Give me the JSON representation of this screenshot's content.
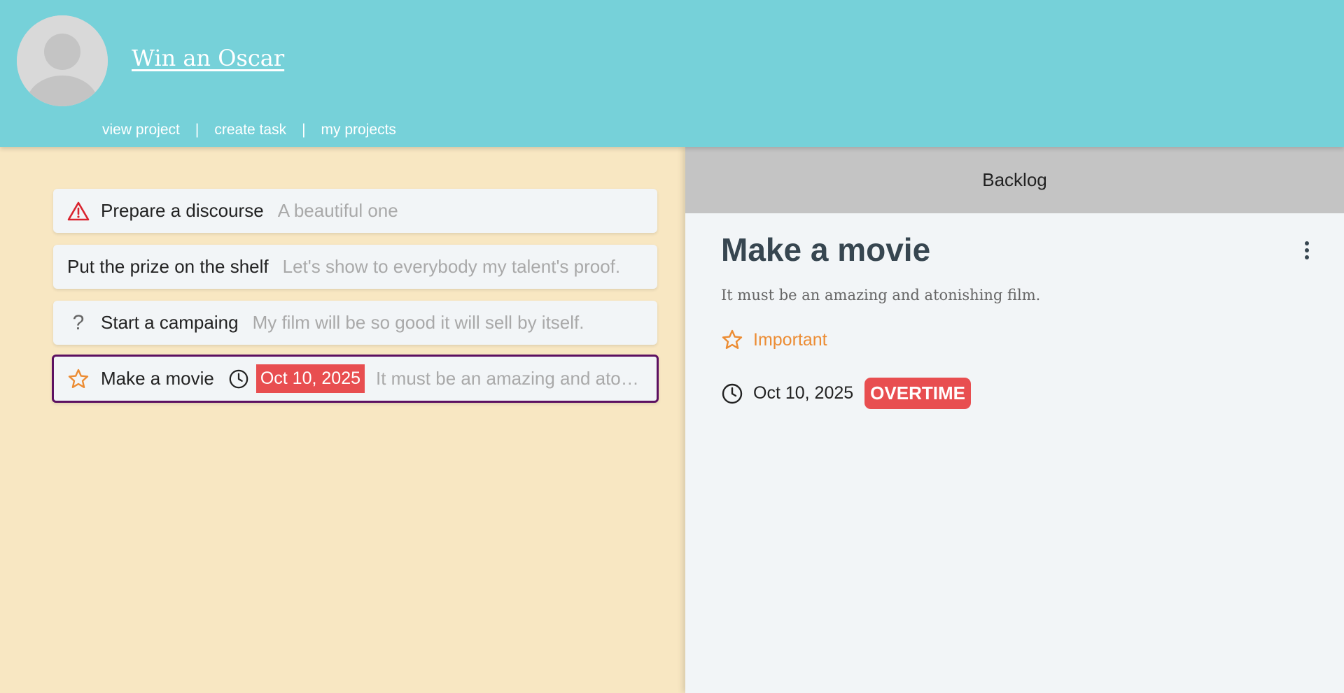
{
  "header": {
    "project_title": "Win an Oscar",
    "nav": [
      {
        "label": "view project"
      },
      {
        "label": "create task"
      },
      {
        "label": "my projects"
      }
    ],
    "separator": "|"
  },
  "tasks": [
    {
      "icon": "warning-icon",
      "title": "Prepare a discourse",
      "description": "A beautiful one"
    },
    {
      "icon": "",
      "title": "Put the prize on the shelf",
      "description": "Let's show to everybody my talent's proof."
    },
    {
      "icon": "question-icon",
      "icon_glyph": "?",
      "title": "Start a campaing",
      "description": "My film will be so good it will sell by itself."
    },
    {
      "icon": "star-icon",
      "title": "Make a movie",
      "due_date": "Oct 10, 2025",
      "description": "It must be an amazing and atonis...",
      "selected": true
    }
  ],
  "detail": {
    "status": "Backlog",
    "title": "Make a movie",
    "description": "It must be an amazing and atonishing film.",
    "priority": "Important",
    "due_date": "Oct 10, 2025",
    "overtime_label": "OVERTIME"
  },
  "colors": {
    "header_bg": "#76d1d9",
    "left_bg": "#f8e7c2",
    "card_bg": "#f2f5f7",
    "selected_border": "#5c1061",
    "overdue_red": "#e84e50",
    "priority_orange": "#ec8c33",
    "warning_red": "#d9232e",
    "status_bar_bg": "#c4c4c4"
  }
}
